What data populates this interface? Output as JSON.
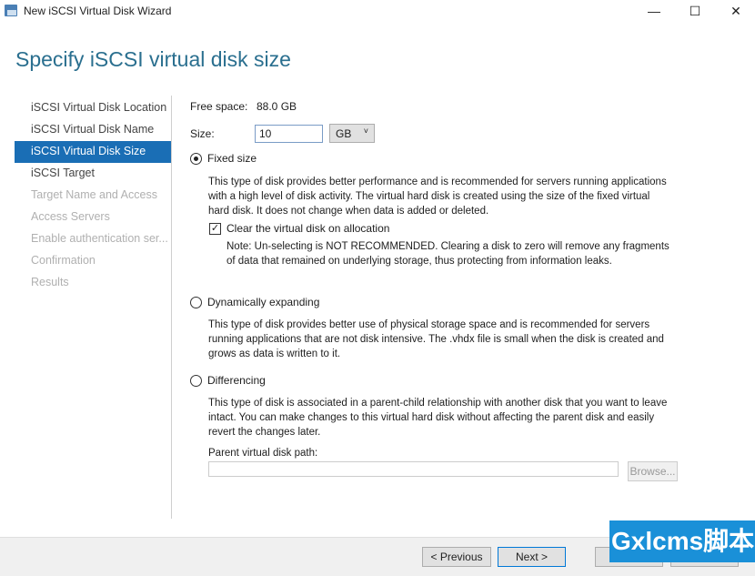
{
  "window": {
    "title": "New iSCSI Virtual Disk Wizard",
    "minimize": "—",
    "maximize": "☐",
    "close": "✕"
  },
  "header": {
    "title": "Specify iSCSI virtual disk size"
  },
  "nav": {
    "items": [
      {
        "label": "iSCSI Virtual Disk Location",
        "state": "done"
      },
      {
        "label": "iSCSI Virtual Disk Name",
        "state": "done"
      },
      {
        "label": "iSCSI Virtual Disk Size",
        "state": "selected"
      },
      {
        "label": "iSCSI Target",
        "state": "enabled"
      },
      {
        "label": "Target Name and Access",
        "state": "disabled"
      },
      {
        "label": "Access Servers",
        "state": "disabled"
      },
      {
        "label": "Enable authentication ser...",
        "state": "disabled"
      },
      {
        "label": "Confirmation",
        "state": "disabled"
      },
      {
        "label": "Results",
        "state": "disabled"
      }
    ]
  },
  "main": {
    "free_space_label": "Free space:",
    "free_space_value": "88.0 GB",
    "size_label": "Size:",
    "size_value": "10",
    "unit": "GB",
    "fixed": {
      "label": "Fixed size",
      "selected": true,
      "desc": "This type of disk provides better performance and is recommended for servers running applications with a high level of disk activity. The virtual hard disk is created using the size of the fixed virtual hard disk. It does not change when data is added or deleted."
    },
    "clear": {
      "label": "Clear the virtual disk on allocation",
      "checked": true,
      "note": "Note: Un-selecting is NOT RECOMMENDED. Clearing a disk to zero will remove any fragments of data that remained on underlying storage, thus protecting from information leaks."
    },
    "dynamic": {
      "label": "Dynamically expanding",
      "selected": false,
      "desc": "This type of disk provides better use of physical storage space and is recommended for servers running applications that are not disk intensive. The .vhdx file is small when the disk is created and grows as data is written to it."
    },
    "diff": {
      "label": "Differencing",
      "selected": false,
      "desc": "This type of disk is associated in a parent-child relationship with another disk that you want to leave intact. You can make changes to this virtual hard disk without affecting the parent disk and easily revert the changes later."
    },
    "parent_label": "Parent virtual disk path:",
    "parent_value": "",
    "browse": "Browse..."
  },
  "footer": {
    "previous": "< Previous",
    "next": "Next >"
  },
  "watermark": "Gxlcms脚本"
}
